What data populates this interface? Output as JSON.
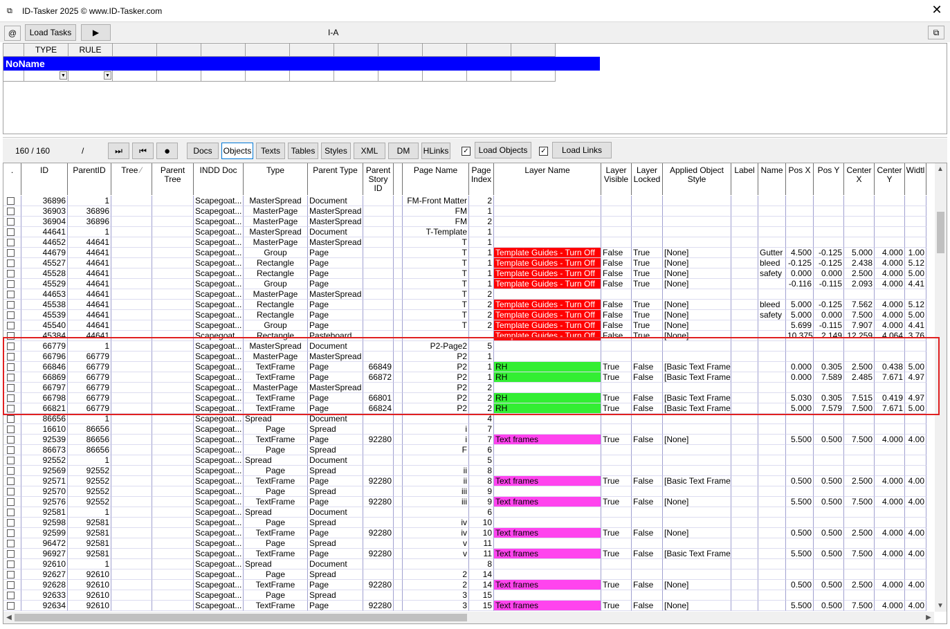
{
  "window": {
    "title": "ID-Tasker 2025   © www.ID-Tasker.com",
    "app_icon": "window-icon"
  },
  "toolbar": {
    "at_label": "@",
    "load_tasks": "Load Tasks",
    "play_icon": "play-icon",
    "center_label": "I-A",
    "restore_icon": "restore-icon"
  },
  "rulegrid": {
    "headers": [
      "",
      "TYPE",
      "RULE",
      "",
      "",
      "",
      "",
      "",
      "",
      "",
      "",
      "",
      ""
    ],
    "noname": "NoName"
  },
  "nav": {
    "counter": "160 / 160",
    "slash": "/",
    "tabs": [
      "Docs",
      "Objects",
      "Texts",
      "Tables",
      "Styles",
      "XML",
      "DM",
      "HLinks"
    ],
    "active_tab": "Objects",
    "load_objects": "Load Objects",
    "load_links": "Load Links",
    "load_objects_checked": true,
    "load_links_checked": true
  },
  "columns": [
    ".",
    "ID",
    "ParentID",
    "Tree",
    "Parent\nTree",
    "INDD Doc",
    "Type",
    "Parent Type",
    "Parent\nStory\nID",
    "",
    "Page Name",
    "Page\nIndex",
    "Layer Name",
    "Layer\nVisible",
    "Layer\nLocked",
    "Applied Object Style",
    "Label",
    "Name",
    "Pos X",
    "Pos Y",
    "Center\nX",
    "Center\nY",
    "Widtl"
  ],
  "rows": [
    [
      "36896",
      "1",
      "",
      "",
      "Scapegoat...",
      "MasterSpread",
      "Document",
      "",
      "FM-Front Matter",
      "2",
      "",
      "",
      "",
      "",
      "",
      "",
      "",
      "",
      "",
      "",
      ""
    ],
    [
      "36903",
      "36896",
      "",
      "",
      "Scapegoat...",
      "MasterPage",
      "MasterSpread",
      "",
      "FM",
      "1",
      "",
      "",
      "",
      "",
      "",
      "",
      "",
      "",
      "",
      "",
      ""
    ],
    [
      "36904",
      "36896",
      "",
      "",
      "Scapegoat...",
      "MasterPage",
      "MasterSpread",
      "",
      "FM",
      "2",
      "",
      "",
      "",
      "",
      "",
      "",
      "",
      "",
      "",
      "",
      ""
    ],
    [
      "44641",
      "1",
      "",
      "",
      "Scapegoat...",
      "MasterSpread",
      "Document",
      "",
      "T-Template",
      "1",
      "",
      "",
      "",
      "",
      "",
      "",
      "",
      "",
      "",
      "",
      ""
    ],
    [
      "44652",
      "44641",
      "",
      "",
      "Scapegoat...",
      "MasterPage",
      "MasterSpread",
      "",
      "T",
      "1",
      "",
      "",
      "",
      "",
      "",
      "",
      "",
      "",
      "",
      "",
      ""
    ],
    [
      "44679",
      "44641",
      "",
      "",
      "Scapegoat...",
      "Group",
      "Page",
      "",
      "T",
      "1",
      "Template Guides - Turn Off",
      "False",
      "True",
      "[None]",
      "",
      "Gutter",
      "4.500",
      "-0.125",
      "5.000",
      "4.000",
      "1.00"
    ],
    [
      "45527",
      "44641",
      "",
      "",
      "Scapegoat...",
      "Rectangle",
      "Page",
      "",
      "T",
      "1",
      "Template Guides - Turn Off",
      "False",
      "True",
      "[None]",
      "",
      "bleed",
      "-0.125",
      "-0.125",
      "2.438",
      "4.000",
      "5.12"
    ],
    [
      "45528",
      "44641",
      "",
      "",
      "Scapegoat...",
      "Rectangle",
      "Page",
      "",
      "T",
      "1",
      "Template Guides - Turn Off",
      "False",
      "True",
      "[None]",
      "",
      "safety",
      "0.000",
      "0.000",
      "2.500",
      "4.000",
      "5.00"
    ],
    [
      "45529",
      "44641",
      "",
      "",
      "Scapegoat...",
      "Group",
      "Page",
      "",
      "T",
      "1",
      "Template Guides - Turn Off",
      "False",
      "True",
      "[None]",
      "",
      "",
      "-0.116",
      "-0.115",
      "2.093",
      "4.000",
      "4.41"
    ],
    [
      "44653",
      "44641",
      "",
      "",
      "Scapegoat...",
      "MasterPage",
      "MasterSpread",
      "",
      "T",
      "2",
      "",
      "",
      "",
      "",
      "",
      "",
      "",
      "",
      "",
      "",
      ""
    ],
    [
      "45538",
      "44641",
      "",
      "",
      "Scapegoat...",
      "Rectangle",
      "Page",
      "",
      "T",
      "2",
      "Template Guides - Turn Off",
      "False",
      "True",
      "[None]",
      "",
      "bleed",
      "5.000",
      "-0.125",
      "7.562",
      "4.000",
      "5.12"
    ],
    [
      "45539",
      "44641",
      "",
      "",
      "Scapegoat...",
      "Rectangle",
      "Page",
      "",
      "T",
      "2",
      "Template Guides - Turn Off",
      "False",
      "True",
      "[None]",
      "",
      "safety",
      "5.000",
      "0.000",
      "7.500",
      "4.000",
      "5.00"
    ],
    [
      "45540",
      "44641",
      "",
      "",
      "Scapegoat...",
      "Group",
      "Page",
      "",
      "T",
      "2",
      "Template Guides - Turn Off",
      "False",
      "True",
      "[None]",
      "",
      "",
      "5.699",
      "-0.115",
      "7.907",
      "4.000",
      "4.41"
    ],
    [
      "45384",
      "44641",
      "",
      "",
      "Scapegoat...",
      "Rectangle",
      "Pasteboard",
      "",
      "",
      "",
      "Template Guides - Turn Off",
      "False",
      "True",
      "[None]",
      "",
      "",
      "10.375",
      "2.149",
      "12.259",
      "4.064",
      "3.76"
    ],
    [
      "66779",
      "1",
      "",
      "",
      "Scapegoat...",
      "MasterSpread",
      "Document",
      "",
      "P2-Page2",
      "5",
      "",
      "",
      "",
      "",
      "",
      "",
      "",
      "",
      "",
      "",
      ""
    ],
    [
      "66796",
      "66779",
      "",
      "",
      "Scapegoat...",
      "MasterPage",
      "MasterSpread",
      "",
      "P2",
      "1",
      "",
      "",
      "",
      "",
      "",
      "",
      "",
      "",
      "",
      "",
      ""
    ],
    [
      "66846",
      "66779",
      "",
      "",
      "Scapegoat...",
      "TextFrame",
      "Page",
      "66849",
      "P2",
      "1",
      "RH",
      "True",
      "False",
      "[Basic Text Frame]",
      "",
      "",
      "0.000",
      "0.305",
      "2.500",
      "0.438",
      "5.00"
    ],
    [
      "66869",
      "66779",
      "",
      "",
      "Scapegoat...",
      "TextFrame",
      "Page",
      "66872",
      "P2",
      "1",
      "RH",
      "True",
      "False",
      "[Basic Text Frame]",
      "",
      "",
      "0.000",
      "7.589",
      "2.485",
      "7.671",
      "4.97"
    ],
    [
      "66797",
      "66779",
      "",
      "",
      "Scapegoat...",
      "MasterPage",
      "MasterSpread",
      "",
      "P2",
      "2",
      "",
      "",
      "",
      "",
      "",
      "",
      "",
      "",
      "",
      "",
      ""
    ],
    [
      "66798",
      "66779",
      "",
      "",
      "Scapegoat...",
      "TextFrame",
      "Page",
      "66801",
      "P2",
      "2",
      "RH",
      "True",
      "False",
      "[Basic Text Frame]",
      "",
      "",
      "5.030",
      "0.305",
      "7.515",
      "0.419",
      "4.97"
    ],
    [
      "66821",
      "66779",
      "",
      "",
      "Scapegoat...",
      "TextFrame",
      "Page",
      "66824",
      "P2",
      "2",
      "RH",
      "True",
      "False",
      "[Basic Text Frame]",
      "",
      "",
      "5.000",
      "7.579",
      "7.500",
      "7.671",
      "5.00"
    ],
    [
      "86656",
      "1",
      "",
      "",
      "Scapegoat...",
      "Spread",
      "Document",
      "",
      "",
      "4",
      "",
      "",
      "",
      "",
      "",
      "",
      "",
      "",
      "",
      "",
      ""
    ],
    [
      "16610",
      "86656",
      "",
      "",
      "Scapegoat...",
      "Page",
      "Spread",
      "",
      "i",
      "7",
      "",
      "",
      "",
      "",
      "",
      "",
      "",
      "",
      "",
      "",
      ""
    ],
    [
      "92539",
      "86656",
      "",
      "",
      "Scapegoat...",
      "TextFrame",
      "Page",
      "92280",
      "i",
      "7",
      "Text frames",
      "True",
      "False",
      "[None]",
      "",
      "",
      "5.500",
      "0.500",
      "7.500",
      "4.000",
      "4.00"
    ],
    [
      "86673",
      "86656",
      "",
      "",
      "Scapegoat...",
      "Page",
      "Spread",
      "",
      "F",
      "6",
      "",
      "",
      "",
      "",
      "",
      "",
      "",
      "",
      "",
      "",
      ""
    ],
    [
      "92552",
      "1",
      "",
      "",
      "Scapegoat...",
      "Spread",
      "Document",
      "",
      "",
      "5",
      "",
      "",
      "",
      "",
      "",
      "",
      "",
      "",
      "",
      "",
      ""
    ],
    [
      "92569",
      "92552",
      "",
      "",
      "Scapegoat...",
      "Page",
      "Spread",
      "",
      "ii",
      "8",
      "",
      "",
      "",
      "",
      "",
      "",
      "",
      "",
      "",
      "",
      ""
    ],
    [
      "92571",
      "92552",
      "",
      "",
      "Scapegoat...",
      "TextFrame",
      "Page",
      "92280",
      "ii",
      "8",
      "Text frames",
      "True",
      "False",
      "[Basic Text Frame]",
      "",
      "",
      "0.500",
      "0.500",
      "2.500",
      "4.000",
      "4.00"
    ],
    [
      "92570",
      "92552",
      "",
      "",
      "Scapegoat...",
      "Page",
      "Spread",
      "",
      "iii",
      "9",
      "",
      "",
      "",
      "",
      "",
      "",
      "",
      "",
      "",
      "",
      ""
    ],
    [
      "92576",
      "92552",
      "",
      "",
      "Scapegoat...",
      "TextFrame",
      "Page",
      "92280",
      "iii",
      "9",
      "Text frames",
      "True",
      "False",
      "[None]",
      "",
      "",
      "5.500",
      "0.500",
      "7.500",
      "4.000",
      "4.00"
    ],
    [
      "92581",
      "1",
      "",
      "",
      "Scapegoat...",
      "Spread",
      "Document",
      "",
      "",
      "6",
      "",
      "",
      "",
      "",
      "",
      "",
      "",
      "",
      "",
      "",
      ""
    ],
    [
      "92598",
      "92581",
      "",
      "",
      "Scapegoat...",
      "Page",
      "Spread",
      "",
      "iv",
      "10",
      "",
      "",
      "",
      "",
      "",
      "",
      "",
      "",
      "",
      "",
      ""
    ],
    [
      "92599",
      "92581",
      "",
      "",
      "Scapegoat...",
      "TextFrame",
      "Page",
      "92280",
      "iv",
      "10",
      "Text frames",
      "True",
      "False",
      "[None]",
      "",
      "",
      "0.500",
      "0.500",
      "2.500",
      "4.000",
      "4.00"
    ],
    [
      "96472",
      "92581",
      "",
      "",
      "Scapegoat...",
      "Page",
      "Spread",
      "",
      "v",
      "11",
      "",
      "",
      "",
      "",
      "",
      "",
      "",
      "",
      "",
      "",
      ""
    ],
    [
      "96927",
      "92581",
      "",
      "",
      "Scapegoat...",
      "TextFrame",
      "Page",
      "92280",
      "v",
      "11",
      "Text frames",
      "True",
      "False",
      "[Basic Text Frame]",
      "",
      "",
      "5.500",
      "0.500",
      "7.500",
      "4.000",
      "4.00"
    ],
    [
      "92610",
      "1",
      "",
      "",
      "Scapegoat...",
      "Spread",
      "Document",
      "",
      "",
      "8",
      "",
      "",
      "",
      "",
      "",
      "",
      "",
      "",
      "",
      "",
      ""
    ],
    [
      "92627",
      "92610",
      "",
      "",
      "Scapegoat...",
      "Page",
      "Spread",
      "",
      "2",
      "14",
      "",
      "",
      "",
      "",
      "",
      "",
      "",
      "",
      "",
      "",
      ""
    ],
    [
      "92628",
      "92610",
      "",
      "",
      "Scapegoat...",
      "TextFrame",
      "Page",
      "92280",
      "2",
      "14",
      "Text frames",
      "True",
      "False",
      "[None]",
      "",
      "",
      "0.500",
      "0.500",
      "2.500",
      "4.000",
      "4.00"
    ],
    [
      "92633",
      "92610",
      "",
      "",
      "Scapegoat...",
      "Page",
      "Spread",
      "",
      "3",
      "15",
      "",
      "",
      "",
      "",
      "",
      "",
      "",
      "",
      "",
      "",
      ""
    ],
    [
      "92634",
      "92610",
      "",
      "",
      "Scapegoat...",
      "TextFrame",
      "Page",
      "92280",
      "3",
      "15",
      "Text frames",
      "True",
      "False",
      "[None]",
      "",
      "",
      "5.500",
      "0.500",
      "7.500",
      "4.000",
      "4.00"
    ]
  ],
  "layer_colors": {
    "Template Guides - Turn Off": "#ff0000",
    "RH": "#33ee33",
    "Text frames": "#ff44ee"
  },
  "highlight_color": "#e02020"
}
